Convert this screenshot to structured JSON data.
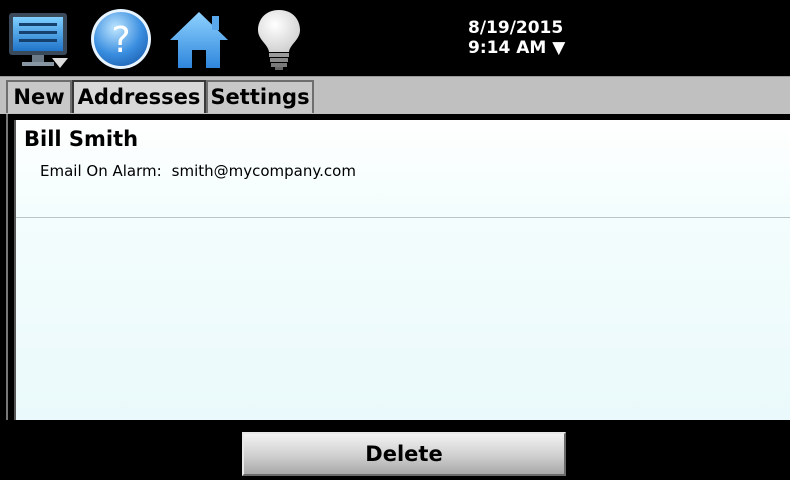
{
  "toolbar": {
    "icons": {
      "menu": "monitor-menu-icon",
      "help": "help-icon",
      "home": "home-icon",
      "alarm": "lightbulb-icon"
    },
    "date": "8/19/2015",
    "time": "9:14 AM",
    "time_dropdown": "▼"
  },
  "tabs": [
    {
      "label": "New",
      "active": false
    },
    {
      "label": "Addresses",
      "active": true
    },
    {
      "label": "Settings",
      "active": false
    }
  ],
  "addresses": [
    {
      "name": "Bill Smith",
      "detail_label": "Email On Alarm:",
      "detail_value": "smith@mycompany.com"
    }
  ],
  "actions": {
    "delete_label": "Delete"
  },
  "colors": {
    "accent_blue": "#2b7fd6",
    "panel_bg": "#eaf9fb",
    "tab_bg": "#c8c8c8"
  }
}
